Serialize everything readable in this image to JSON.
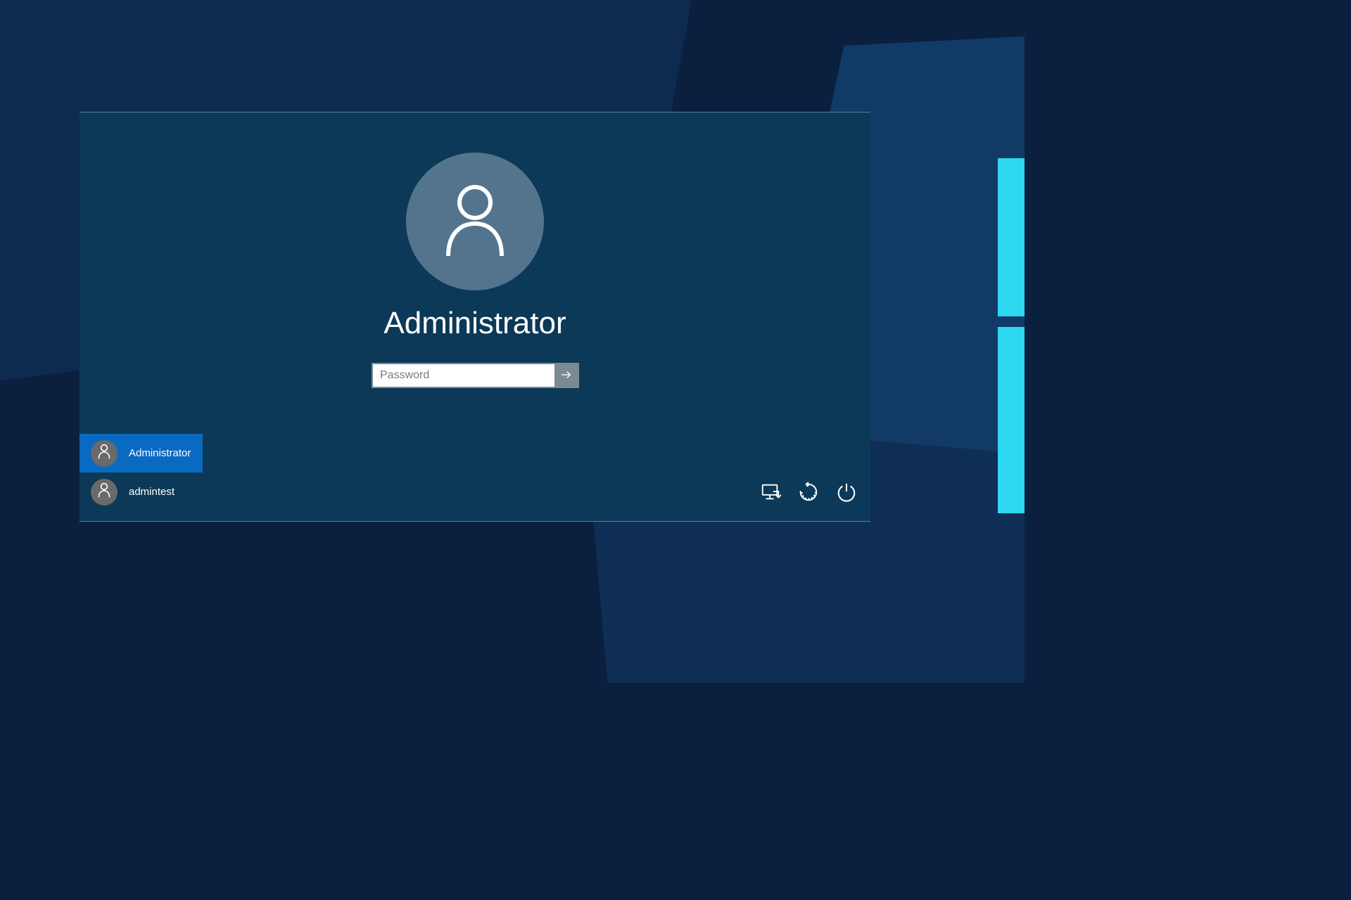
{
  "selected_user": {
    "name": "Administrator"
  },
  "password_field": {
    "placeholder": "Password",
    "value": ""
  },
  "users": [
    {
      "name": "Administrator",
      "selected": true
    },
    {
      "name": "admintest",
      "selected": false
    }
  ],
  "icons": {
    "network": "network-icon",
    "ease_of_access": "ease-of-access-icon",
    "power": "power-icon"
  },
  "colors": {
    "panel_bg": "#0c3957",
    "avatar_bg": "#54748d",
    "selected_user_bg": "#0a6ac2",
    "accent_bars": "#2dd8f0"
  }
}
